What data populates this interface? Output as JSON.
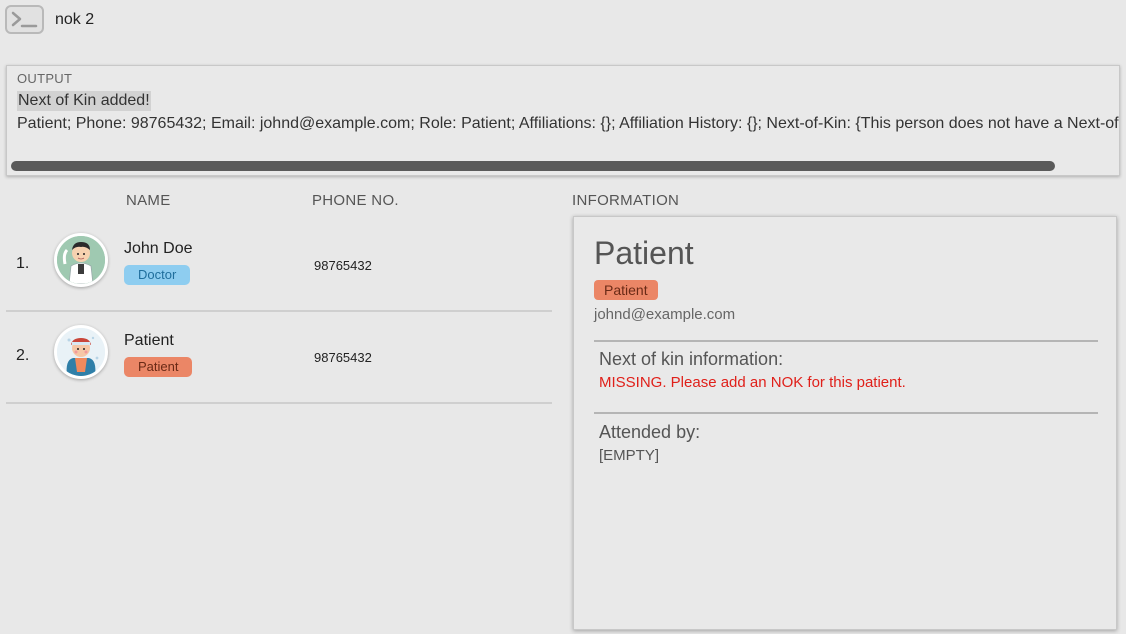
{
  "command": {
    "icon": "terminal-icon",
    "value": "nok 2"
  },
  "output": {
    "title": "OUTPUT",
    "line1": "Next of Kin added!",
    "line2": "Patient; Phone: 98765432; Email: johnd@example.com; Role: Patient; Affiliations: {}; Affiliation History: {}; Next-of-Kin: {This person does not have a Next-of-Kin}"
  },
  "list": {
    "headers": {
      "name": "NAME",
      "phone": "PHONE NO."
    },
    "rows": [
      {
        "index": "1.",
        "name": "John Doe",
        "tag": "Doctor",
        "phone": "98765432",
        "avatar": "doctor-avatar-icon"
      },
      {
        "index": "2.",
        "name": "Patient",
        "tag": "Patient",
        "phone": "98765432",
        "avatar": "patient-avatar-icon"
      }
    ]
  },
  "info": {
    "header": "INFORMATION",
    "name": "Patient",
    "role": "Patient",
    "email": "johnd@example.com",
    "nok_title": "Next of kin information:",
    "nok_value": "MISSING. Please add an NOK for this patient.",
    "attended_title": "Attended by:",
    "attended_value": "[EMPTY]"
  },
  "colors": {
    "doctor_tag": "#8ecdf0",
    "patient_tag": "#eb8666",
    "missing_text": "#e0201a",
    "background": "#e8e8e8"
  }
}
